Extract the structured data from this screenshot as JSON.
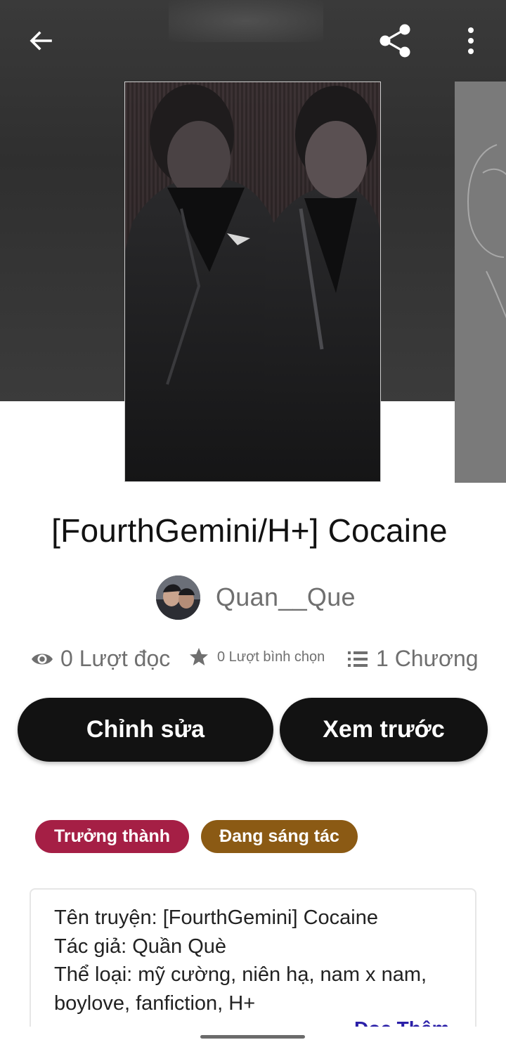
{
  "header": {
    "back_icon": "arrow-left-icon",
    "share_icon": "share-icon",
    "more_icon": "more-vertical-icon"
  },
  "story": {
    "title": "[FourthGemini/H+] Cocaine",
    "author": "Quan__Que"
  },
  "stats": {
    "reads": "0 Lượt đọc",
    "votes": "0 Lượt bình chọn",
    "chapters": "1 Chương"
  },
  "actions": {
    "edit_label": "Chỉnh sửa",
    "preview_label": "Xem trước"
  },
  "tags": [
    {
      "label": "Trưởng thành",
      "color": "#a51f45"
    },
    {
      "label": "Đang sáng tác",
      "color": "#8b5a14"
    }
  ],
  "description": {
    "lines": [
      "Tên truyện: [FourthGemini] Cocaine",
      "Tác giả: Quần Què",
      "Thể loại: mỹ cường, niên hạ, nam x nam,",
      "boylove, fanfiction, H+"
    ],
    "read_more": "Đọc Thêm"
  },
  "colors": {
    "accent_dark": "#121212",
    "mature_tag": "#a51f45",
    "status_tag": "#8b5a14",
    "link": "#2a1fa8"
  }
}
